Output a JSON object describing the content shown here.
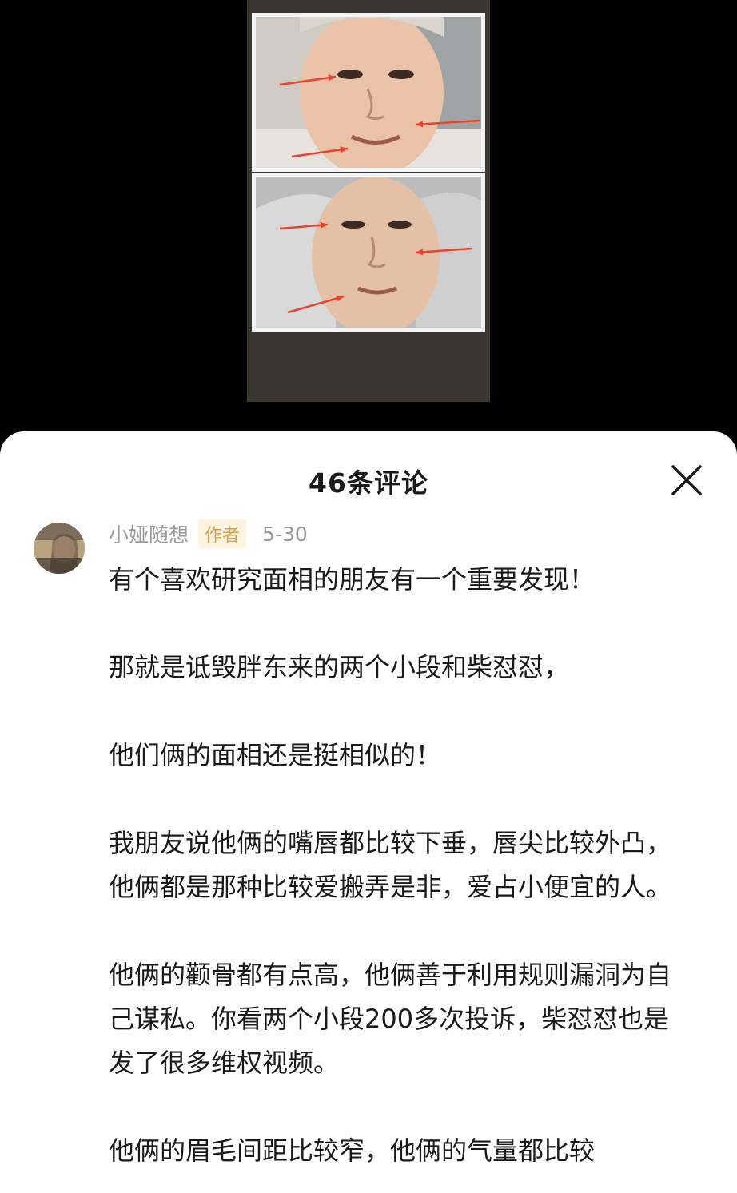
{
  "sheet": {
    "title": "46条评论"
  },
  "comment": {
    "author": "小娅随想",
    "badge": "作者",
    "date": "5-30",
    "paragraphs": [
      "有个喜欢研究面相的朋友有一个重要发现！",
      "那就是诋毁胖东来的两个小段和柴怼怼，",
      "他们俩的面相还是挺相似的！",
      "我朋友说他俩的嘴唇都比较下垂，唇尖比较外凸，他俩都是那种比较爱搬弄是非，爱占小便宜的人。",
      "他俩的颧骨都有点高，他俩善于利用规则漏洞为自己谋私。你看两个小段200多次投诉，柴怼怼也是发了很多维权视频。",
      "他俩的眉毛间距比较窄，他俩的气量都比较"
    ]
  },
  "colors": {
    "arrow": "#e8432e",
    "badge_bg": "#fdf3de",
    "badge_text": "#d6a24a",
    "meta_text": "#9a9a9a"
  },
  "icons": {
    "close": "close-icon"
  }
}
